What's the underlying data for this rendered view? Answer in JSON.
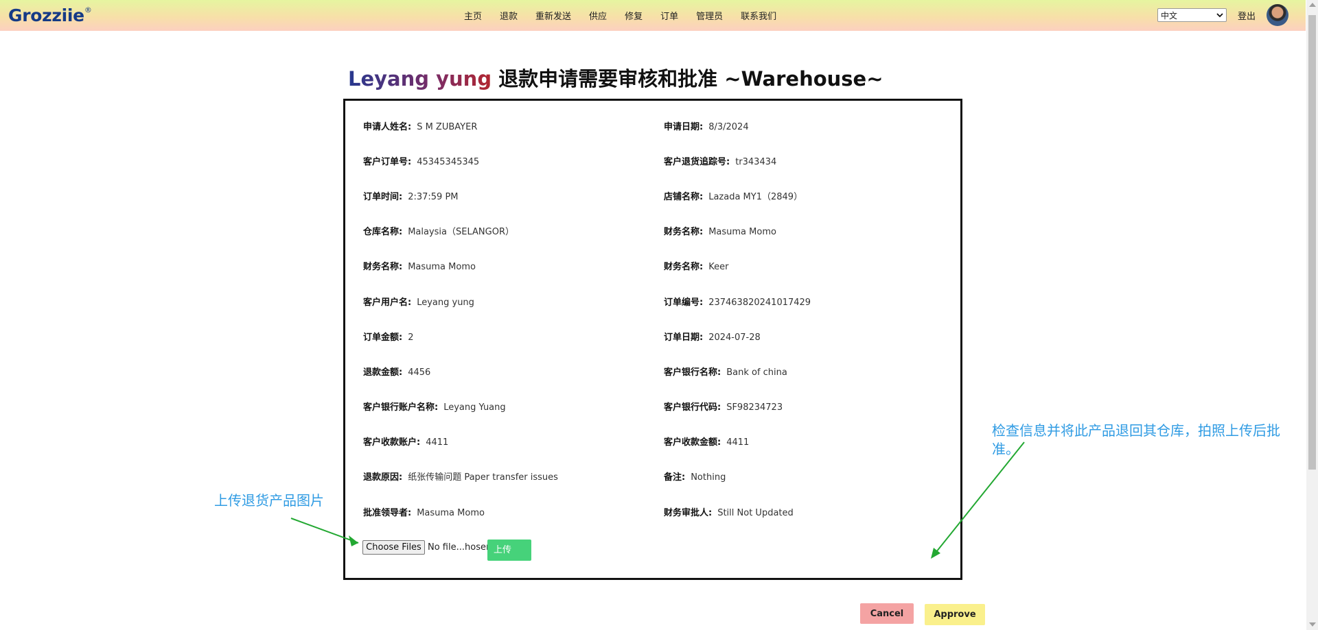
{
  "navbar": {
    "logo": "Grozziie",
    "logo_mark": "®",
    "links": [
      "主页",
      "退款",
      "重新发送",
      "供应",
      "修复",
      "订单",
      "管理员",
      "联系我们"
    ],
    "language": "中文",
    "logout": "登出"
  },
  "heading": {
    "customer": "Leyang yung",
    "title": " 退款申请需要审核和批准 ~Warehouse~"
  },
  "fields": [
    {
      "label": "申请人姓名:",
      "value": "S M ZUBAYER"
    },
    {
      "label": "申请日期:",
      "value": "8/3/2024"
    },
    {
      "label": "客户订单号:",
      "value": "45345345345"
    },
    {
      "label": "客户退货追踪号:",
      "value": "tr343434"
    },
    {
      "label": "订单时间:",
      "value": "2:37:59 PM"
    },
    {
      "label": "店铺名称:",
      "value": "Lazada MY1（2849）"
    },
    {
      "label": "仓库名称:",
      "value": "Malaysia（SELANGOR）"
    },
    {
      "label": "财务名称:",
      "value": "Masuma Momo"
    },
    {
      "label": "财务名称:",
      "value": "Masuma Momo"
    },
    {
      "label": "财务名称:",
      "value": "Keer"
    },
    {
      "label": "客户用户名:",
      "value": "Leyang yung"
    },
    {
      "label": "订单编号:",
      "value": "237463820241017429"
    },
    {
      "label": "订单金额:",
      "value": "2"
    },
    {
      "label": "订单日期:",
      "value": "2024-07-28"
    },
    {
      "label": "退款金额:",
      "value": "4456"
    },
    {
      "label": "客户银行名称:",
      "value": "Bank of china"
    },
    {
      "label": "客户银行账户名称:",
      "value": "Leyang Yuang"
    },
    {
      "label": "客户银行代码:",
      "value": "SF98234723"
    },
    {
      "label": "客户收款账户:",
      "value": "4411"
    },
    {
      "label": "客户收款金额:",
      "value": "4411"
    },
    {
      "label": "退款原因:",
      "value": "纸张传输问题 Paper transfer issues"
    },
    {
      "label": "备注:",
      "value": "Nothing"
    },
    {
      "label": "批准领导者:",
      "value": "Masuma Momo"
    },
    {
      "label": "财务审批人:",
      "value": "Still Not Updated"
    }
  ],
  "upload": {
    "choose_label": "Choose Files",
    "no_file_text": "No file...hosen",
    "upload_label": "上传"
  },
  "actions": {
    "cancel": "Cancel",
    "approve": "Approve"
  },
  "annotations": {
    "left": "上传退货产品图片",
    "right": "检查信息并将此产品退回其仓库，拍照上传后批准。"
  },
  "colors": {
    "annotation_text": "#2f9be3",
    "arrow": "#23a832",
    "upload_button": "#46d27a",
    "cancel_button": "#f4a3a3",
    "approve_button": "#faf08c",
    "brand": "#153a86"
  }
}
